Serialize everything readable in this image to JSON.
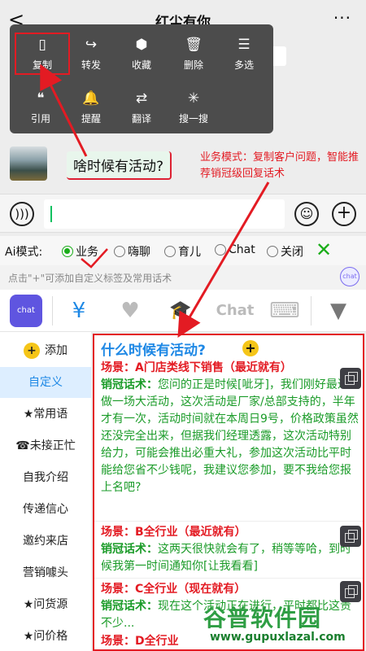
{
  "header": {
    "back": "<",
    "title": "红尘有你",
    "more": "···"
  },
  "popup": {
    "items": [
      {
        "label": "复制",
        "icon": "copy-icon",
        "glyph": "▯"
      },
      {
        "label": "转发",
        "icon": "share-icon",
        "glyph": "↪"
      },
      {
        "label": "收藏",
        "icon": "cube-icon",
        "glyph": "⬢"
      },
      {
        "label": "删除",
        "icon": "trash-icon",
        "glyph": "🗑"
      },
      {
        "label": "多选",
        "icon": "list-icon",
        "glyph": "☰"
      },
      {
        "label": "引用",
        "icon": "quote-icon",
        "glyph": "❝"
      },
      {
        "label": "提醒",
        "icon": "bell-icon",
        "glyph": "🔔"
      },
      {
        "label": "翻译",
        "icon": "translate-icon",
        "glyph": "⇄"
      },
      {
        "label": "搜一搜",
        "icon": "sparkle-icon",
        "glyph": "✳"
      }
    ]
  },
  "chat": {
    "message": "啥时候有活动?"
  },
  "annotation": "业务模式：复制客户问题，智能推荐销冠级回复话术",
  "ai_mode": {
    "label": "Ai模式:",
    "options": [
      "业务",
      "嗨聊",
      "育儿",
      "Chat",
      "关闭"
    ],
    "selected": "业务"
  },
  "hint": "点击\"+\"可添加自定义标签及常用话术",
  "toolbar": {
    "items": [
      "chat",
      "¥",
      "♥",
      "🎓",
      "Chat",
      "⌨",
      "▼"
    ]
  },
  "sidebar": {
    "items": [
      "添加",
      "自定义",
      "★常用语",
      "☎未接正忙",
      "自我介绍",
      "传递信心",
      "邀约来店",
      "营销噱头",
      "★问货源",
      "★问价格"
    ],
    "selected": "自定义"
  },
  "content": {
    "question": "什么时候有活动?",
    "cards": [
      {
        "scene": "场景：A门店类线下销售（最近就有）",
        "script_label": "销冠话术：",
        "script": "您问的正是时候[呲牙]，我们刚好最近要做一场大活动，这次活动是厂家/总部支持的，半年才有一次，活动时间就在本周日9号，价格政策虽然还没完全出来，但据我们经理透露，这次活动特别给力，可能会推出必重大礼，参加这次活动比平时能给您省不少钱呢，我建议您参加，要不我给您报上名吧?"
      },
      {
        "scene": "场景：B全行业（最近就有）",
        "script_label": "销冠话术：",
        "script": "这两天很快就会有了，稍等等哈，到时候我第一时间通知你[让我看看]"
      },
      {
        "scene": "场景：C全行业（现在就有）",
        "script_label": "销冠话术：",
        "script": "现在这个活动正在进行，平时都比这贵不少..."
      },
      {
        "scene": "场景：D全行业",
        "script_label": "",
        "script": ""
      }
    ]
  },
  "watermark": {
    "brand": "谷普软件园",
    "url": "www.gupuxlazal.com"
  }
}
